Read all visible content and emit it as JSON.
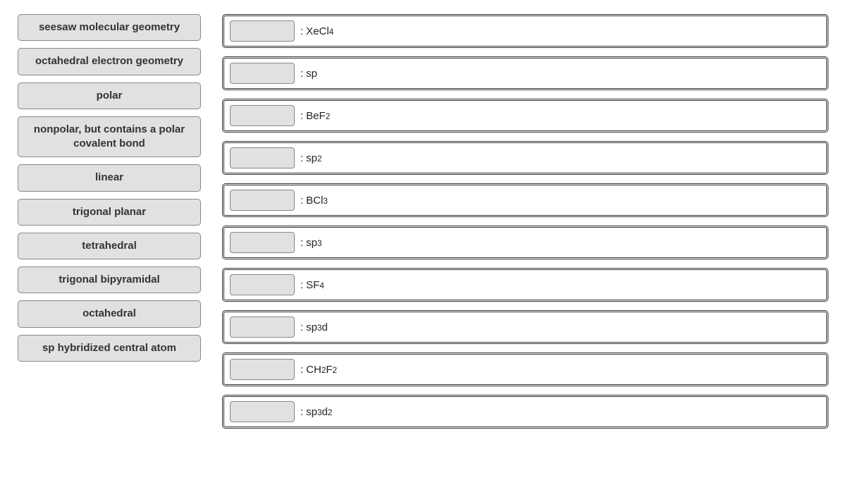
{
  "draggables": [
    {
      "id": "d0",
      "text": "seesaw molecular geometry"
    },
    {
      "id": "d1",
      "text": "octahedral electron geometry"
    },
    {
      "id": "d2",
      "text": "polar"
    },
    {
      "id": "d3",
      "text": "nonpolar, but contains a polar covalent bond"
    },
    {
      "id": "d4",
      "text": "linear"
    },
    {
      "id": "d5",
      "text": "trigonal planar"
    },
    {
      "id": "d6",
      "text": "tetrahedral"
    },
    {
      "id": "d7",
      "text": "trigonal bipyramidal"
    },
    {
      "id": "d8",
      "text": "octahedral"
    },
    {
      "id": "d9",
      "text": "sp hybridized central atom"
    }
  ],
  "targets": [
    {
      "id": "t0",
      "parts": [
        {
          "t": "XeCl"
        },
        {
          "t": "4",
          "sub": true
        }
      ]
    },
    {
      "id": "t1",
      "parts": [
        {
          "t": "sp"
        }
      ]
    },
    {
      "id": "t2",
      "parts": [
        {
          "t": "BeF"
        },
        {
          "t": "2",
          "sub": true
        }
      ]
    },
    {
      "id": "t3",
      "parts": [
        {
          "t": "sp"
        },
        {
          "t": "2",
          "sup": true
        }
      ]
    },
    {
      "id": "t4",
      "parts": [
        {
          "t": "BCl"
        },
        {
          "t": "3",
          "sub": true
        }
      ]
    },
    {
      "id": "t5",
      "parts": [
        {
          "t": "sp"
        },
        {
          "t": "3",
          "sup": true
        }
      ]
    },
    {
      "id": "t6",
      "parts": [
        {
          "t": "SF"
        },
        {
          "t": "4",
          "sub": true
        }
      ]
    },
    {
      "id": "t7",
      "parts": [
        {
          "t": "sp"
        },
        {
          "t": "3",
          "sup": true
        },
        {
          "t": "d"
        }
      ]
    },
    {
      "id": "t8",
      "parts": [
        {
          "t": "CH"
        },
        {
          "t": "2",
          "sub": true
        },
        {
          "t": "F"
        },
        {
          "t": "2",
          "sub": true
        }
      ]
    },
    {
      "id": "t9",
      "parts": [
        {
          "t": "sp"
        },
        {
          "t": "3",
          "sup": true
        },
        {
          "t": "d"
        },
        {
          "t": "2",
          "sup": true
        }
      ]
    }
  ],
  "separator": ":"
}
